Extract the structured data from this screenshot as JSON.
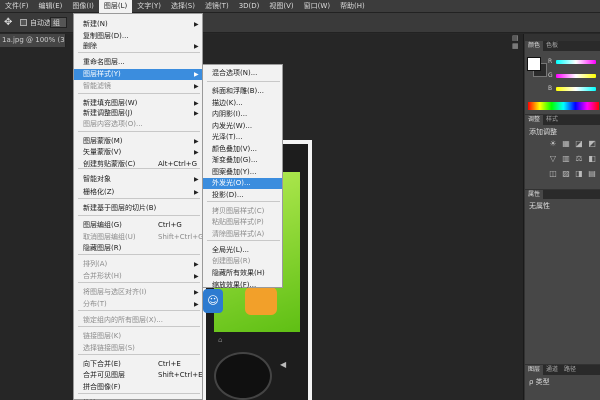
{
  "menubar": [
    "文件(F)",
    "编辑(E)",
    "图像(I)",
    "图层(L)",
    "文字(Y)",
    "选择(S)",
    "滤镜(T)",
    "3D(D)",
    "视图(V)",
    "窗口(W)",
    "帮助(H)"
  ],
  "options": {
    "auto_select_label": "自动选择",
    "auto_select_value": "组"
  },
  "doc_tab": "1a.jpg @ 100% (3.4.1b.",
  "layer_menu": {
    "items": [
      {
        "label": "新建(N)",
        "arrow": true
      },
      {
        "label": "复制图层(D)..."
      },
      {
        "label": "删除",
        "arrow": true
      },
      {
        "label": "重命名图层..."
      },
      {
        "label": "图层样式(Y)",
        "arrow": true,
        "hl": true
      },
      {
        "label": "智能滤镜",
        "arrow": true,
        "disabled": true
      },
      {
        "label": "新建填充图层(W)",
        "arrow": true
      },
      {
        "label": "新建调整图层(J)",
        "arrow": true
      },
      {
        "label": "图层内容选项(O)...",
        "disabled": true
      },
      {
        "label": "图层蒙版(M)",
        "arrow": true
      },
      {
        "label": "矢量蒙版(V)",
        "arrow": true
      },
      {
        "label": "创建剪贴蒙版(C)",
        "shortcut": "Alt+Ctrl+G"
      },
      {
        "label": "智能对象",
        "arrow": true
      },
      {
        "label": "栅格化(Z)",
        "arrow": true
      },
      {
        "label": "新建基于图层的切片(B)"
      },
      {
        "label": "图层编组(G)",
        "shortcut": "Ctrl+G"
      },
      {
        "label": "取消图层编组(U)",
        "shortcut": "Shift+Ctrl+G",
        "disabled": true
      },
      {
        "label": "隐藏图层(R)"
      },
      {
        "label": "排列(A)",
        "arrow": true,
        "disabled": true
      },
      {
        "label": "合并形状(H)",
        "arrow": true,
        "disabled": true
      },
      {
        "label": "将图层与选区对齐(I)",
        "arrow": true,
        "disabled": true
      },
      {
        "label": "分布(T)",
        "arrow": true,
        "disabled": true
      },
      {
        "label": "锁定组内的所有图层(X)...",
        "disabled": true
      },
      {
        "label": "链接图层(K)",
        "disabled": true
      },
      {
        "label": "选择链接图层(S)",
        "disabled": true
      },
      {
        "label": "向下合并(E)",
        "shortcut": "Ctrl+E"
      },
      {
        "label": "合并可见图层",
        "shortcut": "Shift+Ctrl+E"
      },
      {
        "label": "拼合图像(F)"
      },
      {
        "label": "修边",
        "arrow": true
      }
    ]
  },
  "style_menu": {
    "items": [
      {
        "label": "混合选项(N)..."
      },
      {
        "label": "斜面和浮雕(B)..."
      },
      {
        "label": "描边(K)..."
      },
      {
        "label": "内阴影(I)..."
      },
      {
        "label": "内发光(W)..."
      },
      {
        "label": "光泽(T)..."
      },
      {
        "label": "颜色叠加(V)..."
      },
      {
        "label": "渐变叠加(G)..."
      },
      {
        "label": "图案叠加(Y)..."
      },
      {
        "label": "外发光(O)...",
        "hl": true
      },
      {
        "label": "投影(D)..."
      },
      {
        "label": "拷贝图层样式(C)",
        "disabled": true
      },
      {
        "label": "粘贴图层样式(P)",
        "disabled": true
      },
      {
        "label": "清除图层样式(A)",
        "disabled": true
      },
      {
        "label": "全局光(L)..."
      },
      {
        "label": "创建图层(R)",
        "disabled": true
      },
      {
        "label": "隐藏所有效果(H)"
      },
      {
        "label": "缩放效果(F)..."
      }
    ]
  },
  "panels": {
    "color_tabs": [
      "颜色",
      "色板"
    ],
    "rgb_labels": [
      "R",
      "G",
      "B"
    ],
    "adjust_tabs": [
      "调整",
      "样式"
    ],
    "adjust_title": "添加调整",
    "props_tab": "属性",
    "props_text": "无属性",
    "layers_tabs": [
      "图层",
      "通道",
      "路径"
    ],
    "layers_kind": "ρ 类型",
    "accent": "#3b8dde"
  }
}
